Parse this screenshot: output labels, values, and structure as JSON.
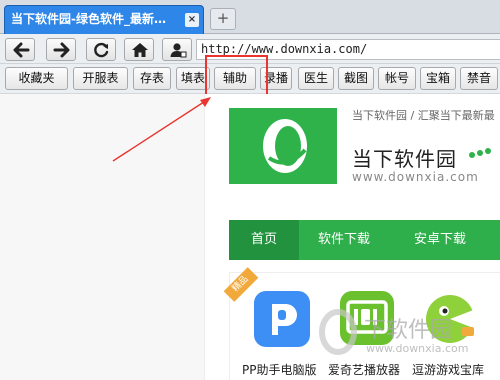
{
  "browser": {
    "tab_title": "当下软件园-绿色软件_最新…",
    "tab_close_glyph": "×",
    "new_tab_glyph": "+",
    "address": "http://www.downxia.com/"
  },
  "nav_buttons": [
    {
      "name": "back-button",
      "icon": "arrow-left-icon"
    },
    {
      "name": "forward-button",
      "icon": "arrow-right-icon"
    },
    {
      "name": "refresh-button",
      "icon": "refresh-icon"
    },
    {
      "name": "home-button",
      "icon": "home-icon"
    },
    {
      "name": "user-button",
      "icon": "user-icon"
    }
  ],
  "bookmarks": [
    "收藏夹",
    "开服表",
    "存表",
    "填表",
    "辅助",
    "录播",
    "医生",
    "截图",
    "帐号",
    "宝箱",
    "禁音"
  ],
  "annotation": {
    "highlight_color": "#e8352f",
    "highlighted_bookmark": "辅助"
  },
  "site": {
    "breadcrumb": "当下软件园 / 汇聚当下最新最",
    "name": "当下软件园",
    "url": "www.downxia.com",
    "brand_color": "#2fb24a",
    "menu": [
      "首页",
      "软件下载",
      "安卓下载"
    ],
    "ribbon": "精品",
    "apps": [
      "PP助手电脑版",
      "爱奇艺播放器",
      "逗游游戏宝库"
    ]
  },
  "watermark": {
    "text": "下软件园",
    "url": "www.downxia.com"
  }
}
